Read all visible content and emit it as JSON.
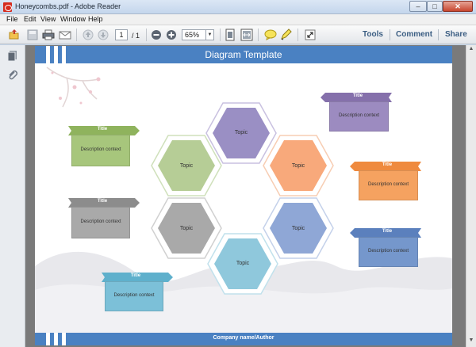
{
  "window": {
    "title": "Honeycombs.pdf - Adobe Reader"
  },
  "menu": [
    "File",
    "Edit",
    "View",
    "Window",
    "Help"
  ],
  "toolbar": {
    "page_current": "1",
    "page_total": "/ 1",
    "zoom": "65%",
    "tools_label": "Tools",
    "comment_label": "Comment",
    "share_label": "Share"
  },
  "document": {
    "title": "Diagram Template",
    "footer": "Company name/Author",
    "hexagons": [
      {
        "label": "Topic",
        "color": "#9a8fc4"
      },
      {
        "label": "Topic",
        "color": "#b6cd96"
      },
      {
        "label": "Topic",
        "color": "#f8a97b"
      },
      {
        "label": "Topic",
        "color": "#a9a9a9"
      },
      {
        "label": "Topic",
        "color": "#8fa7d6"
      },
      {
        "label": "Topic",
        "color": "#8fc8dc"
      }
    ],
    "callouts": [
      {
        "title": "Title",
        "desc": "Description context",
        "color": "#8fb35d"
      },
      {
        "title": "Title",
        "desc": "Description context",
        "color": "#8c8c8c"
      },
      {
        "title": "Title",
        "desc": "Description context",
        "color": "#5fb0cc"
      },
      {
        "title": "Title",
        "desc": "Description context",
        "color": "#8570ab"
      },
      {
        "title": "Title",
        "desc": "Description context",
        "color": "#ef8a3e"
      },
      {
        "title": "Title",
        "desc": "Description context",
        "color": "#5b80bd"
      }
    ]
  }
}
